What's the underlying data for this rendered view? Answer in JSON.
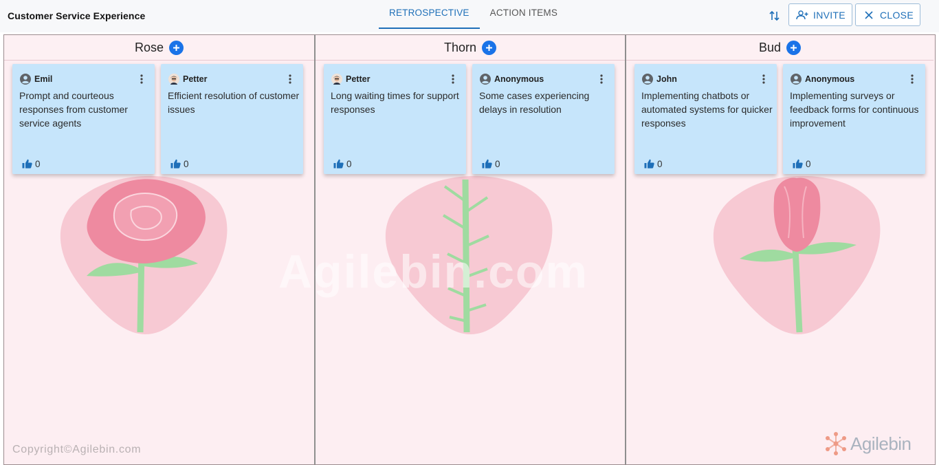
{
  "header": {
    "title": "Customer Service Experience",
    "tabs": [
      {
        "label": "RETROSPECTIVE",
        "active": true
      },
      {
        "label": "ACTION ITEMS",
        "active": false
      }
    ],
    "invite_label": "INVITE",
    "close_label": "CLOSE"
  },
  "columns": [
    {
      "title": "Rose",
      "cards": [
        {
          "author": "Emil",
          "avatar": "person-icon",
          "text": "Prompt and courteous responses from customer service agents",
          "likes": "0"
        },
        {
          "author": "Petter",
          "avatar": "photo-avatar",
          "text": "Efficient resolution of customer issues",
          "likes": "0"
        }
      ]
    },
    {
      "title": "Thorn",
      "cards": [
        {
          "author": "Petter",
          "avatar": "photo-avatar",
          "text": "Long waiting times for support responses",
          "likes": "0"
        },
        {
          "author": "Anonymous",
          "avatar": "person-icon",
          "text": "Some cases experiencing delays in resolution",
          "likes": "0"
        }
      ]
    },
    {
      "title": "Bud",
      "cards": [
        {
          "author": "John",
          "avatar": "person-icon",
          "text": "Implementing chatbots or automated systems for quicker responses",
          "likes": "0"
        },
        {
          "author": "Anonymous",
          "avatar": "person-icon",
          "text": "Implementing surveys or feedback forms for continuous improvement",
          "likes": "0"
        }
      ]
    }
  ],
  "watermark": "Agilebin.com",
  "footer": {
    "copyright": "Copyright©Agilebin.com",
    "brand": "Agilebin"
  },
  "colors": {
    "accent": "#1e6fb8",
    "add_button": "#1a73e8",
    "card": "#c6e5fb",
    "column_bg": "#fdeef2"
  }
}
